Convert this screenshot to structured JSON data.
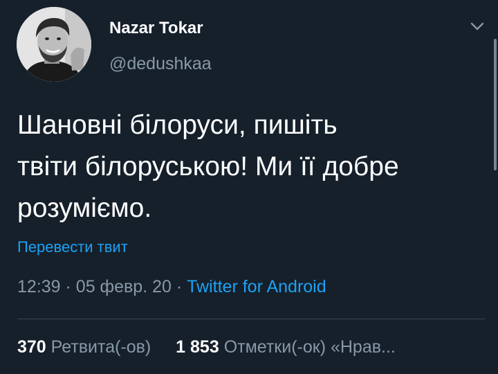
{
  "tweet": {
    "author": {
      "display_name": "Nazar Tokar",
      "handle": "@dedushkaa"
    },
    "text": "Шановні білоруси, пишіть\nтвіти білоруською! Ми її добре\nрозуміємо.",
    "translate_link": "Перевести твит",
    "time": "12:39",
    "separator": "·",
    "date": "05 февр. 20",
    "source": "Twitter for Android",
    "stats": {
      "retweets_count": "370",
      "retweets_label": "Ретвита(-ов)",
      "likes_count": "1 853",
      "likes_label": "Отметки(-ок) «Нрав..."
    }
  },
  "icons": {
    "menu": "chevron-down-icon",
    "avatar": "avatar"
  },
  "colors": {
    "background": "#15202b",
    "text_primary": "#ffffff",
    "text_secondary": "#8899a6",
    "accent": "#1da1f2",
    "divider": "#38444d"
  }
}
